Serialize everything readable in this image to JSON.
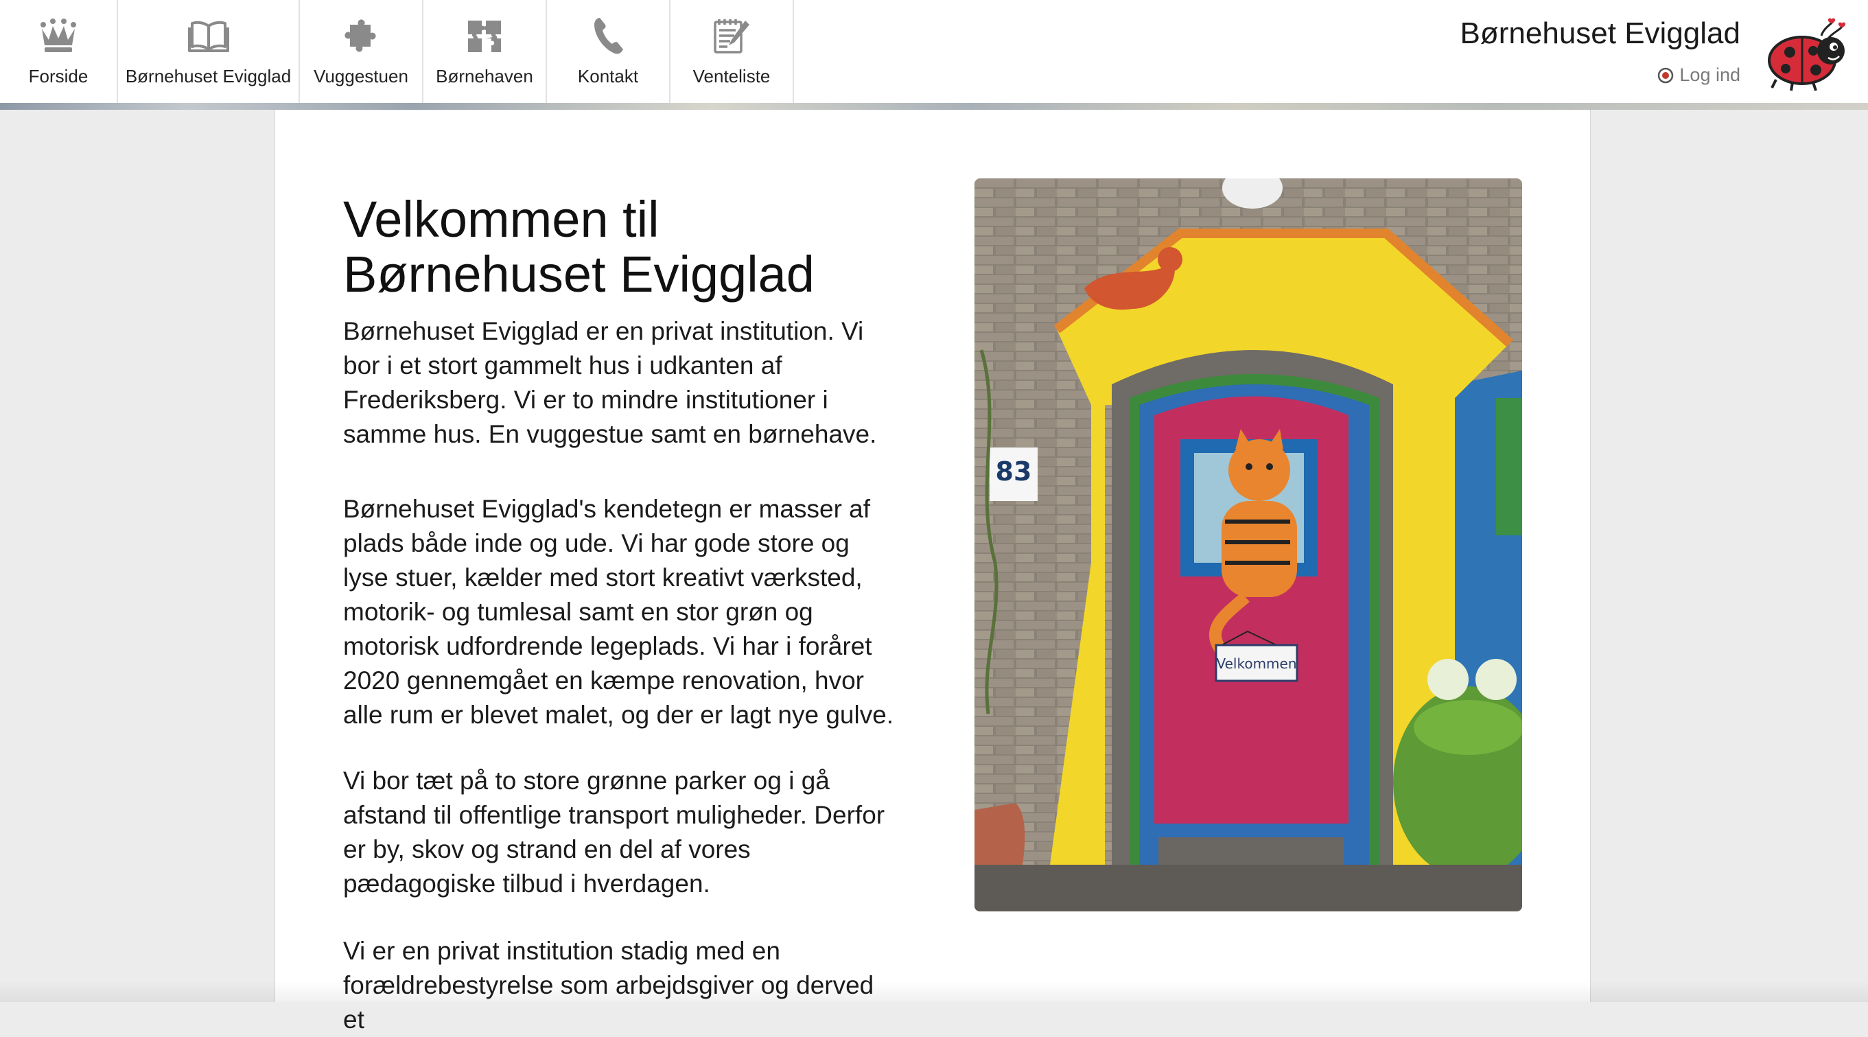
{
  "nav": {
    "items": [
      {
        "label": "Forside",
        "icon": "crown-icon"
      },
      {
        "label": "Børnehuset Evigglad",
        "icon": "book-icon"
      },
      {
        "label": "Vuggestuen",
        "icon": "puzzle-piece-icon"
      },
      {
        "label": "Børnehaven",
        "icon": "puzzle-pieces-icon"
      },
      {
        "label": "Kontakt",
        "icon": "phone-icon"
      },
      {
        "label": "Venteliste",
        "icon": "notepad-icon"
      }
    ]
  },
  "header": {
    "site_title": "Børnehuset Evigglad",
    "login_label": "Log ind",
    "logo": "ladybug-logo"
  },
  "main": {
    "title": "Velkommen til Børnehuset Evigglad",
    "paragraphs": [
      "Børnehuset Evigglad er en privat institution. Vi bor i et stort gammelt hus i udkanten af Frederiksberg. Vi er to mindre institutioner i samme hus. En vuggestue samt en børnehave.",
      "Børnehuset Evigglad's kendetegn er masser af plads både inde og ude. Vi har gode store og lyse stuer, kælder med stort kreativt værksted, motorik- og tumlesal samt en stor grøn og motorisk udfordrende legeplads. Vi har i foråret 2020 gennemgået en kæmpe renovation, hvor alle rum er blevet malet, og der er lagt nye gulve.",
      "Vi bor tæt på to store grønne parker og i gå afstand til offentlige transport muligheder. Derfor er by, skov og strand en del af vores pædagogiske tilbud i hverdagen.",
      "Vi er en privat institution stadig med en forældrebestyrelse som arbejdsgiver og derved et"
    ]
  },
  "photo": {
    "house_number": "83",
    "sign_text": "Velkommen"
  },
  "colors": {
    "background": "#ececec",
    "card": "#ffffff",
    "icon_gray": "#8a8a8a"
  }
}
